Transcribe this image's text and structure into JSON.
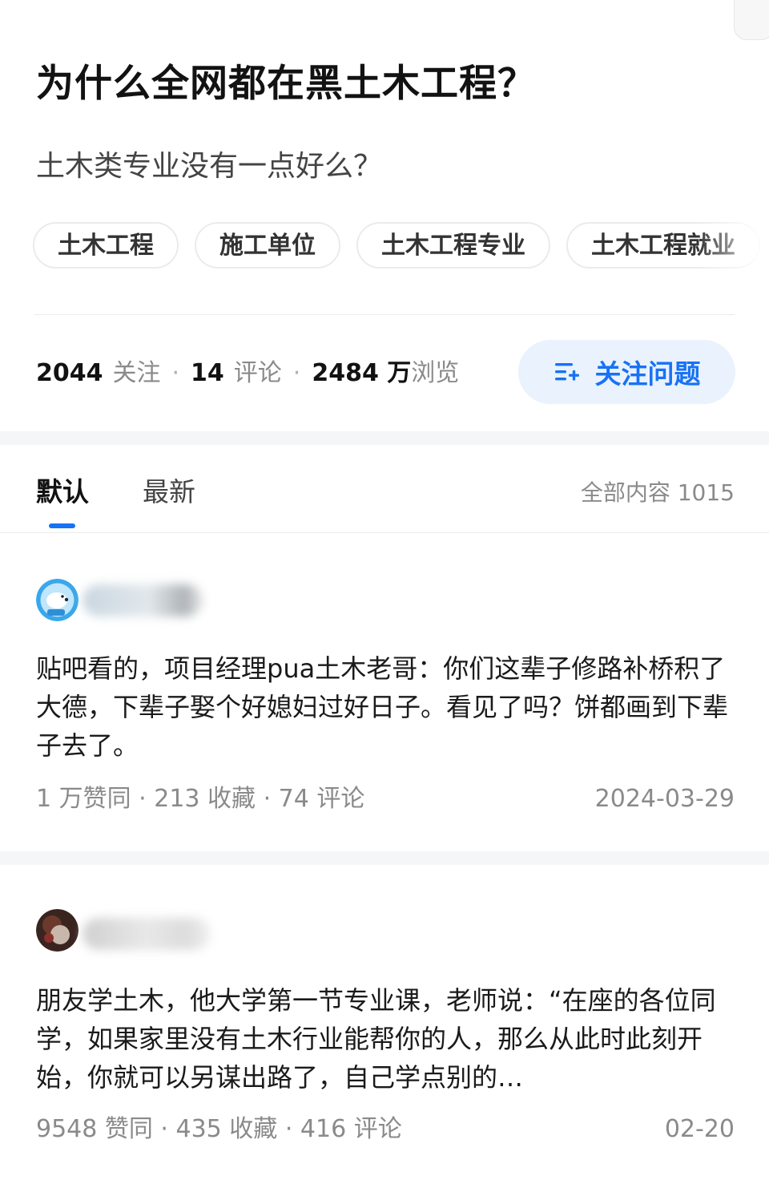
{
  "question": {
    "title": "为什么全网都在黑土木工程？",
    "description": "土木类专业没有一点好么？",
    "tags": [
      "土木工程",
      "施工单位",
      "土木工程专业",
      "土木工程就业"
    ],
    "stats": {
      "followers": "2044",
      "followers_label": "关注",
      "comments": "14",
      "comments_label": "评论",
      "views": "2484 万",
      "views_label": "浏览"
    },
    "follow_button_label": "关注问题",
    "follow_icon": "add-list-icon"
  },
  "tabs": {
    "default_label": "默认",
    "latest_label": "最新",
    "total_label": "全部内容 1015"
  },
  "answers": [
    {
      "text": "贴吧看的，项目经理pua土木老哥：你们这辈子修路补桥积了大德，下辈子娶个好媳妇过好日子。看见了吗？饼都画到下辈子去了。",
      "meta": "1 万赞同 · 213 收藏 · 74 评论",
      "date": "2024-03-29"
    },
    {
      "text": "朋友学土木，他大学第一节专业课，老师说：“在座的各位同学，如果家里没有土木行业能帮你的人，那么从此时此刻开始，你就可以另谋出路了，自己学点别的…",
      "meta": "9548 赞同 · 435 收藏 · 416 评论",
      "date": "02-20"
    }
  ],
  "colors": {
    "accent": "#1772f6",
    "follow_button_bg": "#eaf2fd",
    "muted_text": "#8a8a8a",
    "section_band": "#f5f6f8"
  }
}
